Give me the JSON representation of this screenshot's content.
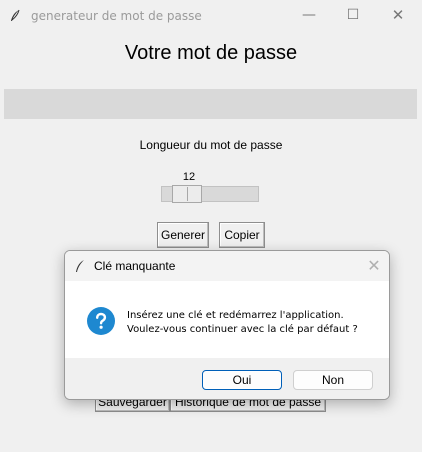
{
  "window": {
    "title": "generateur de mot de passe",
    "controls": {
      "minimize": "—",
      "maximize": "☐",
      "close": "✕"
    }
  },
  "main": {
    "heading": "Votre mot de passe",
    "password_value": "",
    "length_label": "Longueur du mot de passe",
    "length_value": "12",
    "buttons": {
      "generate": "Generer",
      "copy": "Copier",
      "save": "Sauvegarder",
      "history": "Historique de mot de passe"
    }
  },
  "dialog": {
    "title": "Clé manquante",
    "message_line1": "Insérez une clé et redémarrez l'application.",
    "message_line2": "Voulez-vous continuer avec la clé par défaut ?",
    "icon": "question-icon",
    "close": "✕",
    "buttons": {
      "yes": "Oui",
      "no": "Non"
    }
  },
  "colors": {
    "accent": "#005fb8",
    "question_icon": "#1e88d0"
  }
}
